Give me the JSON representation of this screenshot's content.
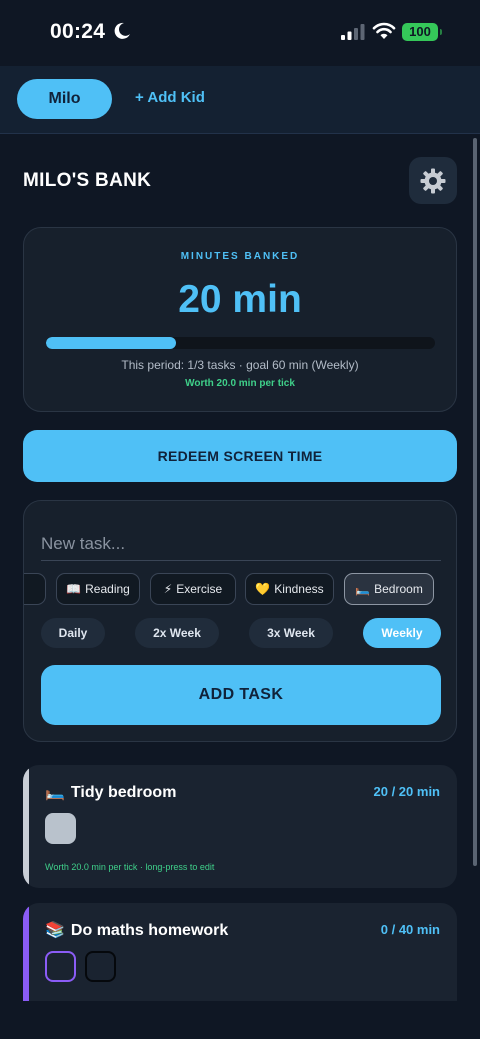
{
  "status_bar": {
    "time": "00:24",
    "battery": "100",
    "icons": [
      "moon-icon",
      "cellular-signal-icon",
      "wifi-icon",
      "battery-icon"
    ]
  },
  "kids": {
    "active": "Milo",
    "add_label": "+ Add Kid"
  },
  "bank": {
    "title": "MILO'S BANK",
    "minutes_label": "MINUTES BANKED",
    "minutes_value": "20 min",
    "progress_fraction": 0.333,
    "period_text": "This period: 1/3 tasks · goal 60 min (Weekly)",
    "worth_text": "Worth 20.0 min per tick"
  },
  "redeem_label": "REDEEM SCREEN TIME",
  "new_task": {
    "placeholder": "New task...",
    "categories": [
      {
        "label": "",
        "icon": "",
        "selected": false
      },
      {
        "label": "Reading",
        "icon": "📖",
        "selected": false
      },
      {
        "label": "Exercise",
        "icon": "⚡",
        "selected": false
      },
      {
        "label": "Kindness",
        "icon": "💛",
        "selected": false
      },
      {
        "label": "Bedroom",
        "icon": "🛏️",
        "selected": true
      }
    ],
    "frequencies": [
      {
        "label": "Daily",
        "selected": false
      },
      {
        "label": "2x Week",
        "selected": false
      },
      {
        "label": "3x Week",
        "selected": false
      },
      {
        "label": "Weekly",
        "selected": true
      }
    ],
    "add_label": "ADD TASK"
  },
  "tasks": [
    {
      "icon": "🛏️",
      "title": "Tidy bedroom",
      "progress": "20 / 20 min",
      "accent": "#c9ced6",
      "hint": "Worth 20.0 min per tick · long-press to edit",
      "ticks": [
        "done"
      ]
    },
    {
      "icon": "📚",
      "title": "Do maths homework",
      "progress": "0 / 40 min",
      "accent": "#8b5cf6",
      "ticks": [
        "current",
        "empty"
      ]
    }
  ],
  "colors": {
    "accent": "#4fc0f6",
    "background": "#0f1724",
    "success": "#3fd08a",
    "purple": "#8b5cf6"
  }
}
